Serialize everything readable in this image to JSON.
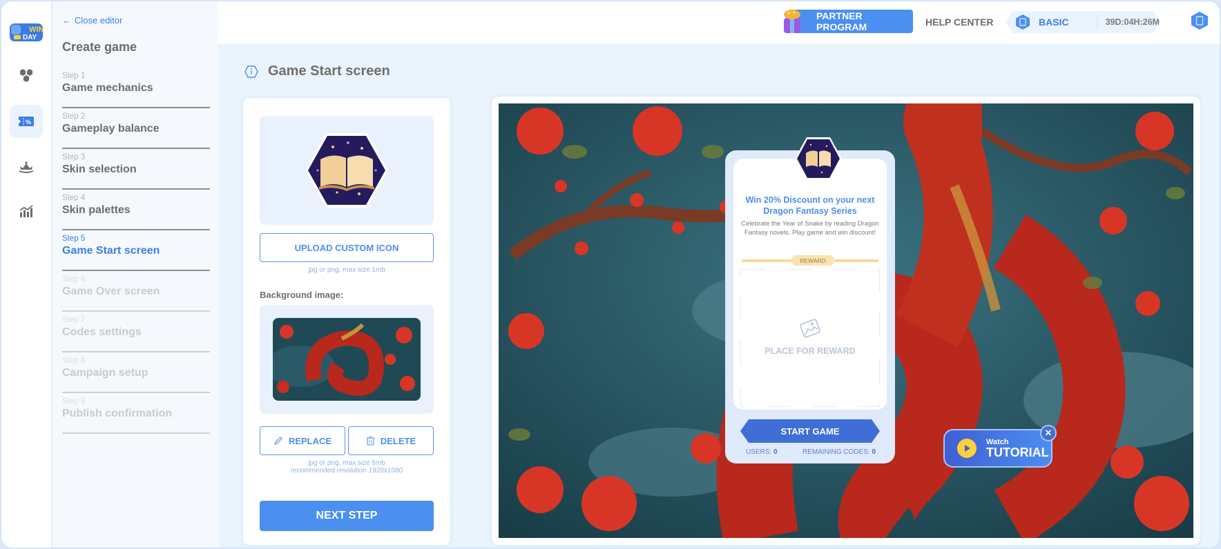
{
  "app": {
    "brand": "WIN DAY"
  },
  "rail": {
    "items": [
      {
        "icon": "games-icon",
        "active": false
      },
      {
        "icon": "coupon-icon",
        "active": true
      },
      {
        "icon": "crown-icon",
        "active": false
      },
      {
        "icon": "analytics-icon",
        "active": false
      }
    ]
  },
  "sidebar": {
    "close_editor": "Close editor",
    "title": "Create game",
    "steps": [
      {
        "num": "Step 1",
        "name": "Game mechanics",
        "state": "done"
      },
      {
        "num": "Step 2",
        "name": "Gameplay balance",
        "state": "done"
      },
      {
        "num": "Step 3",
        "name": "Skin selection",
        "state": "done"
      },
      {
        "num": "Step 4",
        "name": "Skin palettes",
        "state": "done"
      },
      {
        "num": "Step 5",
        "name": "Game Start screen",
        "state": "active"
      },
      {
        "num": "Step 6",
        "name": "Game Over screen",
        "state": "disabled"
      },
      {
        "num": "Step 7",
        "name": "Codes settings",
        "state": "disabled"
      },
      {
        "num": "Step 8",
        "name": "Campaign setup",
        "state": "disabled"
      },
      {
        "num": "Step 9",
        "name": "Publish confirmation",
        "state": "disabled"
      }
    ]
  },
  "topbar": {
    "partner_program": "PARTNER PROGRAM",
    "help_center": "HELP CENTER",
    "plan_name": "BASIC",
    "plan_time": "39D:04H:26M"
  },
  "main": {
    "title": "Game Start screen",
    "upload_icon_label": "UPLOAD CUSTOM ICON",
    "icon_hint": "jpg or png, max size 1mb",
    "bg_label": "Background image:",
    "replace_label": "REPLACE",
    "delete_label": "DELETE",
    "bg_hint_1": "jpg or png, max size 6mb",
    "bg_hint_2": "recommended resolution 1920x1080",
    "next_step": "NEXT STEP"
  },
  "preview": {
    "title": "Win 20% Discount on your next Dragon Fantasy Series",
    "description": "Celebrate the Year of Snake by reading Dragon Fantasy novels. Play game and win discount!",
    "reward_tag": "REWARD",
    "reward_placeholder": "PLACE FOR REWARD",
    "start_game": "START GAME",
    "users_label": "USERS:",
    "users_value": "0",
    "codes_label": "REMAINING CODES:",
    "codes_value": "0"
  },
  "tutorial": {
    "watch": "Watch",
    "main": "TUTORIAL"
  },
  "colors": {
    "accent": "#4b8ff0",
    "dark_accent": "#3f6fd6",
    "reward": "#f7d99a",
    "tutorial_play": "#fbd13a"
  }
}
